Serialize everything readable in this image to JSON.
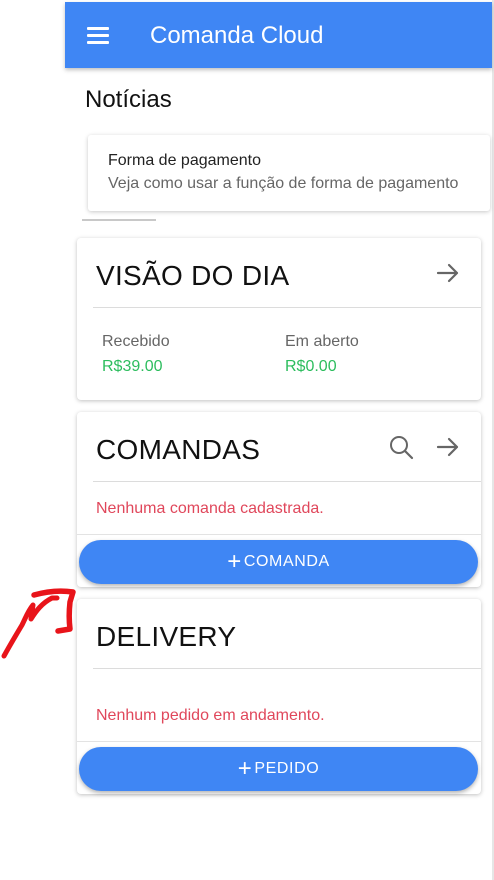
{
  "toolbar": {
    "title": "Comanda Cloud",
    "menu_icon": "menu-icon",
    "background": "#3f86f4"
  },
  "news": {
    "section_title": "Notícias",
    "card": {
      "title": "Forma de pagamento",
      "subtitle": "Veja como usar a função de forma de pagamento"
    }
  },
  "visao_dia": {
    "title": "VISÃO DO DIA",
    "arrow_icon": "arrow-right-icon",
    "received_label": "Recebido",
    "received_value": "R$39.00",
    "open_label": "Em aberto",
    "open_value": "R$0.00"
  },
  "comandas": {
    "title": "COMANDAS",
    "search_icon": "search-icon",
    "arrow_icon": "arrow-right-icon",
    "empty_message": "Nenhuma comanda cadastrada.",
    "button_plus": "+",
    "button_label": "COMANDA"
  },
  "delivery": {
    "title": "DELIVERY",
    "empty_message": "Nenhum pedido em andamento.",
    "button_plus": "+",
    "button_label": "PEDIDO"
  },
  "colors": {
    "primary": "#3f86f4",
    "success": "#2dbd5e",
    "danger": "#e0475b",
    "annotation": "#e8141a"
  }
}
